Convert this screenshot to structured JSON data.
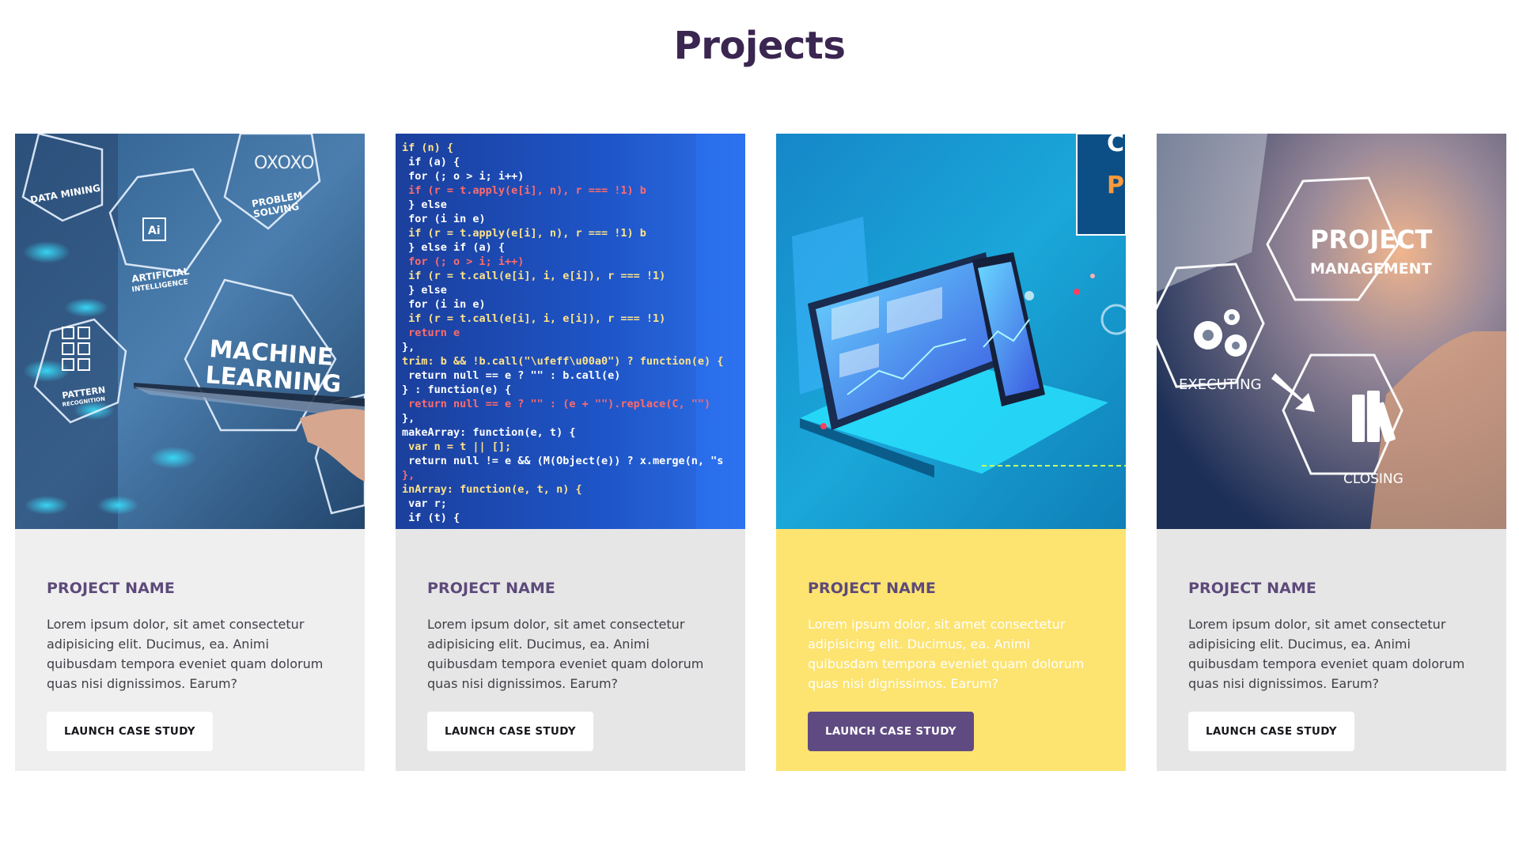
{
  "page": {
    "title": "Projects"
  },
  "cards": [
    {
      "image_icon": "machine-learning-image",
      "image_text": {
        "data_mining": "DATA MINING",
        "ai_badge": "Ai",
        "ai_label_1": "ARTIFICIAL",
        "ai_label_2": "INTELLIGENCE",
        "problem_1": "PROBLEM",
        "problem_2": "SOLVING",
        "pattern_1": "PATTERN",
        "pattern_2": "RECOGNITION",
        "ml_1": "MACHINE",
        "ml_2": "LEARNING"
      },
      "title": "PROJECT NAME",
      "description": "Lorem ipsum dolor, sit amet consectetur adipisicing elit. Ducimus, ea. Animi quibusdam tempora eveniet quam dolorum quas nisi dignissimos. Earum?",
      "button_label": "LAUNCH CASE STUDY"
    },
    {
      "image_icon": "code-screen-image",
      "code_lines": [
        "  if (n) {",
        "    if (a) {",
        "      for (; o > i; i++)",
        "        if (r = t.apply(e[i], n), r === !1) b",
        "    } else",
        "      for (i in e)",
        "        if (r = t.apply(e[i], n), r === !1) b",
        "  } else if (a) {",
        "    for (; o > i; i++)",
        "      if (r = t.call(e[i], i, e[i]), r === !1)",
        "  } else",
        "    for (i in e)",
        "      if (r = t.call(e[i], i, e[i]), r === !1)",
        "  return e",
        "},",
        "trim: b && !b.call(\"\\ufeff\\u00a0\") ? function(e) {",
        "  return null == e ? \"\" : b.call(e)",
        "} : function(e) {",
        "  return null == e ? \"\" : (e + \"\").replace(C, \"\")",
        "},",
        "makeArray: function(e, t) {",
        "  var n = t || [];",
        "  return null != e && (M(Object(e)) ? x.merge(n, \"s",
        "},",
        "inArray: function(e, t, n) {",
        "  var r;",
        "  if (t) {"
      ],
      "title": "PROJECT NAME",
      "description": "Lorem ipsum dolor, sit amet consectetur adipisicing elit. Ducimus, ea. Animi quibusdam tempora eveniet quam dolorum quas nisi dignissimos. Earum?",
      "button_label": "LAUNCH CASE STUDY"
    },
    {
      "image_icon": "responsive-devices-image",
      "image_text": {
        "corner_1": "C",
        "corner_2": "P"
      },
      "title": "PROJECT NAME",
      "description": "Lorem ipsum dolor, sit amet consectetur adipisicing elit. Ducimus, ea. Animi quibusdam tempora eveniet quam dolorum quas nisi dignissimos. Earum?",
      "button_label": "LAUNCH CASE STUDY"
    },
    {
      "image_icon": "project-management-image",
      "image_text": {
        "pm_1": "PROJECT",
        "pm_2": "MANAGEMENT",
        "executing": "EXECUTING",
        "closing": "CLOSING"
      },
      "title": "PROJECT NAME",
      "description": "Lorem ipsum dolor, sit amet consectetur adipisicing elit. Ducimus, ea. Animi quibusdam tempora eveniet quam dolorum quas nisi dignissimos. Earum?",
      "button_label": "LAUNCH CASE STUDY"
    }
  ],
  "colors": {
    "title": "#3a2651",
    "card_title": "#5d4a7a",
    "card_bg": "#e6e6e7",
    "card_highlight_bg": "#fde370",
    "button_highlight_bg": "#5f4b82"
  }
}
